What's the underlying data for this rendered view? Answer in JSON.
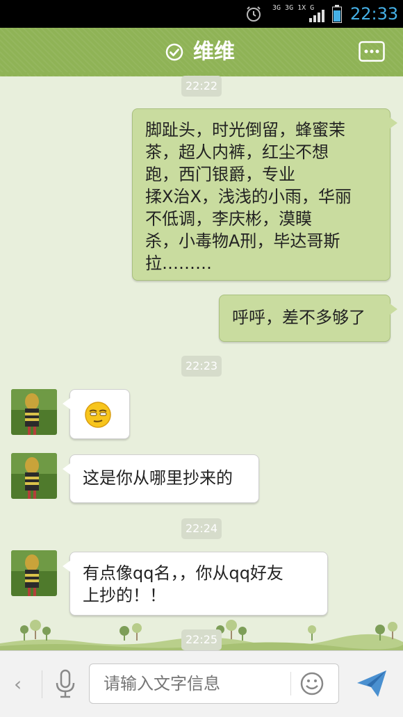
{
  "status_bar": {
    "time": "22:33",
    "network_top": "3G 3G 1X G",
    "icons": [
      "alarm-clock-icon",
      "signal-icon",
      "battery-icon"
    ],
    "time_color": "#45b0e6"
  },
  "header": {
    "title": "维维",
    "verified_icon": "check-circle-icon",
    "more_icon": "more-dots-icon",
    "color": "#8fb356"
  },
  "messages": [
    {
      "type": "timestamp",
      "text": "22:22"
    },
    {
      "type": "outgoing",
      "lines": [
        "脚趾头，时光倒留，蜂蜜茉",
        "茶，超人内裤，红尘不想",
        "跑，西门银爵，专业",
        "揉X治X，浅浅的小雨，华丽",
        "不低调，李庆彬，漠瞙",
        "杀，小毒物A刑，毕达哥斯",
        "拉………"
      ]
    },
    {
      "type": "outgoing",
      "lines": [
        "呼呼，差不多够了"
      ]
    },
    {
      "type": "timestamp",
      "text": "22:23"
    },
    {
      "type": "incoming",
      "emoji": "smirk-face-emoji"
    },
    {
      "type": "incoming",
      "lines": [
        "这是你从哪里抄来的"
      ]
    },
    {
      "type": "timestamp",
      "text": "22:24"
    },
    {
      "type": "incoming",
      "lines": [
        "有点像qq名，，你从qq好友",
        "上抄的！！"
      ]
    },
    {
      "type": "timestamp",
      "text": "22:25"
    }
  ],
  "input_bar": {
    "placeholder": "请输入文字信息",
    "icons": [
      "back-chevron-icon",
      "microphone-icon",
      "emoji-icon",
      "send-icon"
    ]
  }
}
